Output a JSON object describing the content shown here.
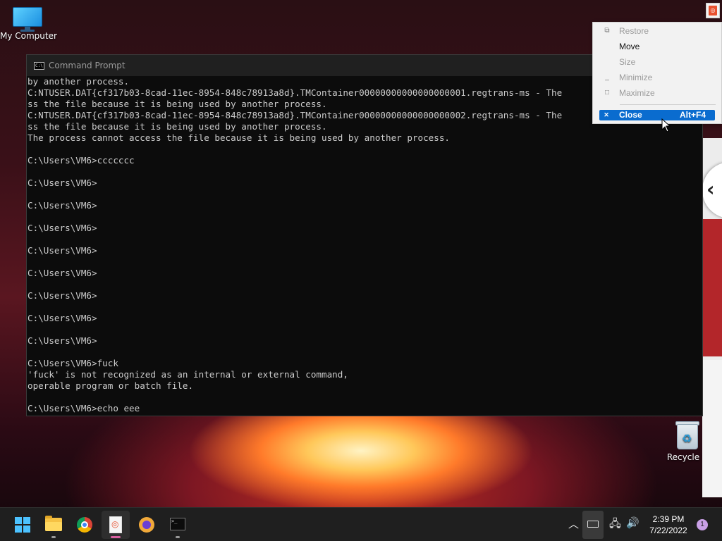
{
  "desktop": {
    "my_computer_label": "My Computer",
    "recycle_bin_label": "Recycle B"
  },
  "cmd": {
    "title": "Command Prompt",
    "icon_text": "C:\\",
    "lines": [
      "by another process.",
      "C:NTUSER.DAT{cf317b03-8cad-11ec-8954-848c78913a8d}.TMContainer00000000000000000001.regtrans-ms - The",
      "ss the file because it is being used by another process.",
      "C:NTUSER.DAT{cf317b03-8cad-11ec-8954-848c78913a8d}.TMContainer00000000000000000002.regtrans-ms - The",
      "ss the file because it is being used by another process.",
      "The process cannot access the file because it is being used by another process.",
      "",
      "C:\\Users\\VM6>ccccccc",
      "",
      "C:\\Users\\VM6>",
      "",
      "C:\\Users\\VM6>",
      "",
      "C:\\Users\\VM6>",
      "",
      "C:\\Users\\VM6>",
      "",
      "C:\\Users\\VM6>",
      "",
      "C:\\Users\\VM6>",
      "",
      "C:\\Users\\VM6>",
      "",
      "C:\\Users\\VM6>",
      "",
      "C:\\Users\\VM6>fuck",
      "'fuck' is not recognized as an internal or external command,",
      "operable program or batch file.",
      "",
      "C:\\Users\\VM6>echo eee"
    ]
  },
  "sysmenu": {
    "restore": "Restore",
    "move": "Move",
    "size": "Size",
    "minimize": "Minimize",
    "maximize": "Maximize",
    "close": "Close",
    "close_accel": "Alt+F4"
  },
  "icons": {
    "restore": "restore-icon",
    "minimize": "minimize-icon",
    "maximize": "maximize-icon",
    "close": "close-icon",
    "chevron": "chevron-left-icon"
  },
  "taskbar": {
    "time": "2:39 PM",
    "date": "7/22/2022",
    "notification_count": "1",
    "terminal_icon_text": ">_"
  },
  "colors": {
    "accent": "#0a6ccf",
    "console_bg": "#0c0c0c",
    "console_fg": "#cccccc",
    "taskbar_bg": "#1f1f1f"
  }
}
